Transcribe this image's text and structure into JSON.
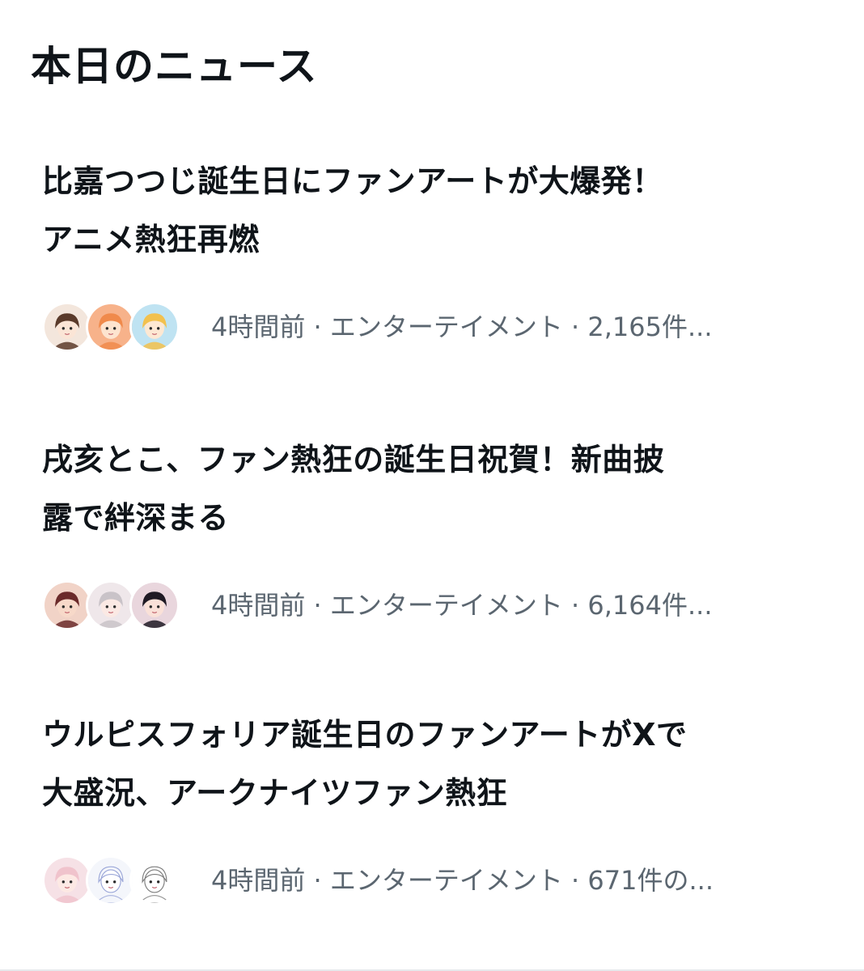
{
  "section": {
    "title": "本日のニュース"
  },
  "news": [
    {
      "headline_line1": "比嘉つつじ誕生日にファンアートが大爆発！",
      "headline_line2": "アニメ熱狂再燃",
      "meta": "4時間前 · エンターテイメント · 2,165件...",
      "avatars": [
        {
          "icon": "anime-girl-brown-hair-avatar",
          "bg": "#f3e6dc",
          "hair": "#5a3a2a",
          "skin": "#fbe5d6"
        },
        {
          "icon": "anime-girl-orange-hair-avatar",
          "bg": "#f7b28a",
          "hair": "#f08a4b",
          "skin": "#fde4cf"
        },
        {
          "icon": "anime-girl-blonde-hair-avatar",
          "bg": "#bfe3f2",
          "hair": "#f2c14e",
          "skin": "#fde8d3"
        }
      ]
    },
    {
      "headline_line1": "戌亥とこ、ファン熱狂の誕生日祝賀！新曲披",
      "headline_line2": "露で絆深まる",
      "meta": "4時間前 · エンターテイメント · 6,164件...",
      "avatars": [
        {
          "icon": "anime-character-dark-red-avatar",
          "bg": "#f1d3c7",
          "hair": "#6b2a2a",
          "skin": "#f7d9c9"
        },
        {
          "icon": "anime-character-silver-hair-avatar",
          "bg": "#efe7ea",
          "hair": "#c9c3c8",
          "skin": "#fbe9e4"
        },
        {
          "icon": "anime-character-black-hair-avatar",
          "bg": "#e9d6dd",
          "hair": "#1f1a24",
          "skin": "#fae1d8"
        }
      ]
    },
    {
      "headline_line1": "ウルピスフォリア誕生日のファンアートがXで",
      "headline_line2": "大盛況、アークナイツファン熱狂",
      "meta": "4時間前 · エンターテイメント · 671件の...",
      "avatars": [
        {
          "icon": "anime-character-pink-hair-avatar",
          "bg": "#f6e1e6",
          "hair": "#f0c3cc",
          "skin": "#fde9e4"
        },
        {
          "icon": "sketch-character-avatar",
          "bg": "#f4f6fb",
          "hair": "#9aa6d8",
          "skin": "#ffffff"
        },
        {
          "icon": "sketch-chibi-avatar",
          "bg": "#ffffff",
          "hair": "#7b7b7b",
          "skin": "#ffffff"
        }
      ]
    }
  ]
}
